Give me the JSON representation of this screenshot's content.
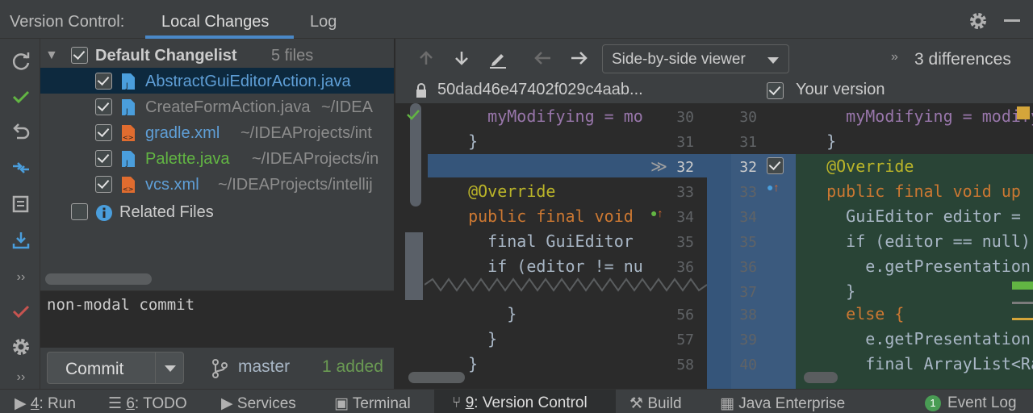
{
  "header": {
    "title": "Version Control:",
    "tabs": [
      {
        "label": "Local Changes",
        "active": true
      },
      {
        "label": "Log",
        "active": false
      }
    ]
  },
  "left_toolbar": {
    "icons": [
      "refresh-icon",
      "check-icon",
      "rollback-icon",
      "diff-arrows-icon",
      "commit-message-icon",
      "update-icon",
      "more-icon",
      "commit-check-icon",
      "gear-icon",
      "more-icon"
    ]
  },
  "tree": {
    "changelist": {
      "label": "Default Changelist",
      "count": "5 files"
    },
    "files": [
      {
        "name": "AbstractGuiEditorAction.java",
        "path": "",
        "color": "#5f9fd7",
        "type": "java"
      },
      {
        "name": "CreateFormAction.java",
        "path": "~/IDEA",
        "color": "#8c8c8c",
        "type": "java"
      },
      {
        "name": "gradle.xml",
        "path": "~/IDEAProjects/int",
        "color": "#5f9fd7",
        "type": "xml"
      },
      {
        "name": "Palette.java",
        "path": "~/IDEAProjects/in",
        "color": "#62b543",
        "type": "java"
      },
      {
        "name": "vcs.xml",
        "path": "~/IDEAProjects/intellij",
        "color": "#5f9fd7",
        "type": "xml"
      }
    ],
    "related": "Related Files"
  },
  "commit": {
    "message": "non-modal commit",
    "button_label": "Commit",
    "branch": "master",
    "added": "1 added"
  },
  "diff_toolbar": {
    "viewer": "Side-by-side viewer",
    "differences": "3 differences",
    "expand": "»"
  },
  "diff_header": {
    "left_revision": "50dad46e47402f029c4aab...",
    "right_label": "Your version"
  },
  "left_code": [
    {
      "text": "    myModifying = mo",
      "cls": "fld"
    },
    {
      "text": "  }",
      "cls": "txt"
    },
    {
      "text": "",
      "cls": "txt"
    },
    {
      "text": "  @Override",
      "cls": "ann"
    },
    {
      "text": "  public final void ",
      "cls": "kw"
    },
    {
      "text": "    final GuiEditor ",
      "cls": "txt"
    },
    {
      "text": "    if (editor != nu",
      "cls": "txt"
    },
    {
      "text": "",
      "cls": "txt"
    },
    {
      "text": "      }",
      "cls": "txt"
    },
    {
      "text": "    }",
      "cls": "txt"
    },
    {
      "text": "  }",
      "cls": "txt"
    }
  ],
  "left_line_numbers": [
    "30",
    "31",
    "32",
    "33",
    "34",
    "35",
    "36",
    "",
    "56",
    "57",
    "58"
  ],
  "right_line_numbers": [
    "30",
    "31",
    "32",
    "33",
    "34",
    "35",
    "36",
    "37",
    "38",
    "39",
    "40"
  ],
  "right_code": [
    {
      "text": "    myModifying = modify",
      "cls": "fld"
    },
    {
      "text": "  }",
      "cls": "txt"
    },
    {
      "text": "  @Override",
      "cls": "ann"
    },
    {
      "text": "  public final void up",
      "cls": "kw"
    },
    {
      "text": "    GuiEditor editor = ",
      "cls": "txt"
    },
    {
      "text": "    if (editor == null) ",
      "cls": "txt"
    },
    {
      "text": "      e.getPresentation(",
      "cls": "txt"
    },
    {
      "text": "    }",
      "cls": "txt"
    },
    {
      "text": "    else {",
      "cls": "kw"
    },
    {
      "text": "      e.getPresentation(",
      "cls": "txt"
    },
    {
      "text": "      final ArrayList<Ra",
      "cls": "txt"
    }
  ],
  "status_bar": {
    "items": [
      {
        "num": "4",
        "label": ": Run"
      },
      {
        "num": "6",
        "label": ": TODO"
      },
      {
        "num": "",
        "label": "Services"
      },
      {
        "num": "",
        "label": "Terminal"
      },
      {
        "num": "9",
        "label": ": Version Control"
      },
      {
        "num": "",
        "label": "Build"
      },
      {
        "num": "",
        "label": "Java Enterprise"
      }
    ],
    "event_log": "Event Log",
    "event_count": "1"
  },
  "colors": {
    "accent": "#4a88c7",
    "added_green": "#62b543",
    "modified_blue": "#5f9fd7",
    "changed_bg": "#35557a",
    "inserted_bg": "#294436"
  }
}
